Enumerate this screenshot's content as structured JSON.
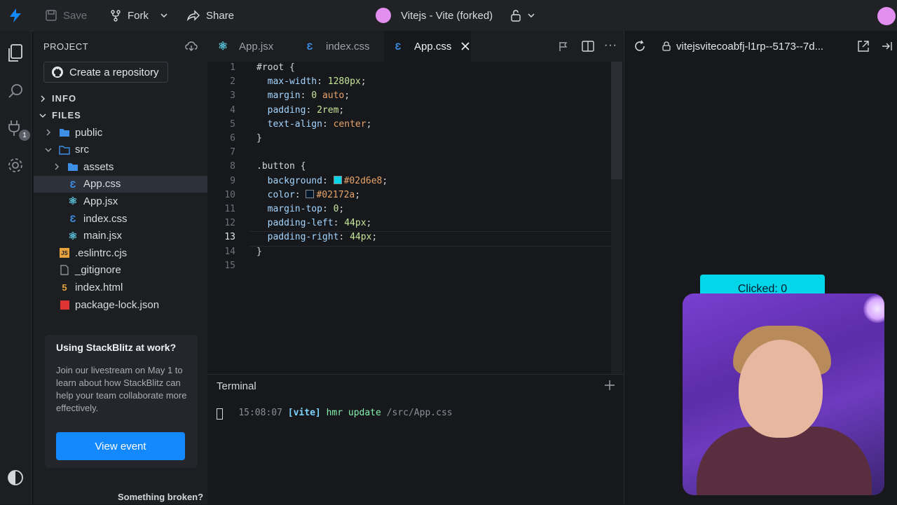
{
  "topbar": {
    "save_label": "Save",
    "fork_label": "Fork",
    "share_label": "Share",
    "project_title": "Vitejs - Vite (forked)"
  },
  "sidebar": {
    "header": "PROJECT",
    "create_repo": "Create a repository",
    "sections": {
      "info": "INFO",
      "files": "FILES"
    },
    "tree": [
      {
        "label": "public",
        "kind": "folder",
        "depth": 1,
        "open": false
      },
      {
        "label": "src",
        "kind": "folder",
        "depth": 1,
        "open": true
      },
      {
        "label": "assets",
        "kind": "folder",
        "depth": 2,
        "open": false
      },
      {
        "label": "App.css",
        "kind": "css",
        "depth": 2,
        "selected": true
      },
      {
        "label": "App.jsx",
        "kind": "react",
        "depth": 2
      },
      {
        "label": "index.css",
        "kind": "css",
        "depth": 2
      },
      {
        "label": "main.jsx",
        "kind": "react",
        "depth": 2
      },
      {
        "label": ".eslintrc.cjs",
        "kind": "js",
        "depth": 1
      },
      {
        "label": "_gitignore",
        "kind": "file",
        "depth": 1
      },
      {
        "label": "index.html",
        "kind": "html",
        "depth": 1
      },
      {
        "label": "package-lock.json",
        "kind": "json",
        "depth": 1
      }
    ],
    "promo": {
      "title": "Using StackBlitz at work?",
      "body": "Join our livestream on May 1 to learn about how StackBlitz can help your team collaborate more effectively.",
      "button": "View event"
    },
    "broken": "Something broken?",
    "activity_badge": "1"
  },
  "tabs": [
    {
      "label": "App.jsx",
      "active": false
    },
    {
      "label": "index.css",
      "active": false
    },
    {
      "label": "App.css",
      "active": true
    }
  ],
  "editor": {
    "current_line": 13,
    "lines": [
      "#root {",
      "  max-width: 1280px;",
      "  margin: 0 auto;",
      "  padding: 2rem;",
      "  text-align: center;",
      "}",
      "",
      ".button {",
      "  background: #02d6e8;",
      "  color: #02172a;",
      "  margin-top: 0;",
      "  padding-left: 44px;",
      "  padding-right: 44px;",
      "}",
      ""
    ],
    "colors": {
      "swatch_bg": "#02d6e8",
      "swatch_fg": "#02172a"
    }
  },
  "terminal": {
    "title": "Terminal",
    "time": "15:08:07",
    "tag": "[vite]",
    "msg": "hmr update",
    "path": "/src/App.css"
  },
  "preview": {
    "url": "vitejsvitecoabfj-l1rp--5173--7d...",
    "button_label": "Clicked: 0",
    "button_bg": "#02d6e8",
    "button_fg": "#02172a"
  },
  "accent": "#1389fd"
}
